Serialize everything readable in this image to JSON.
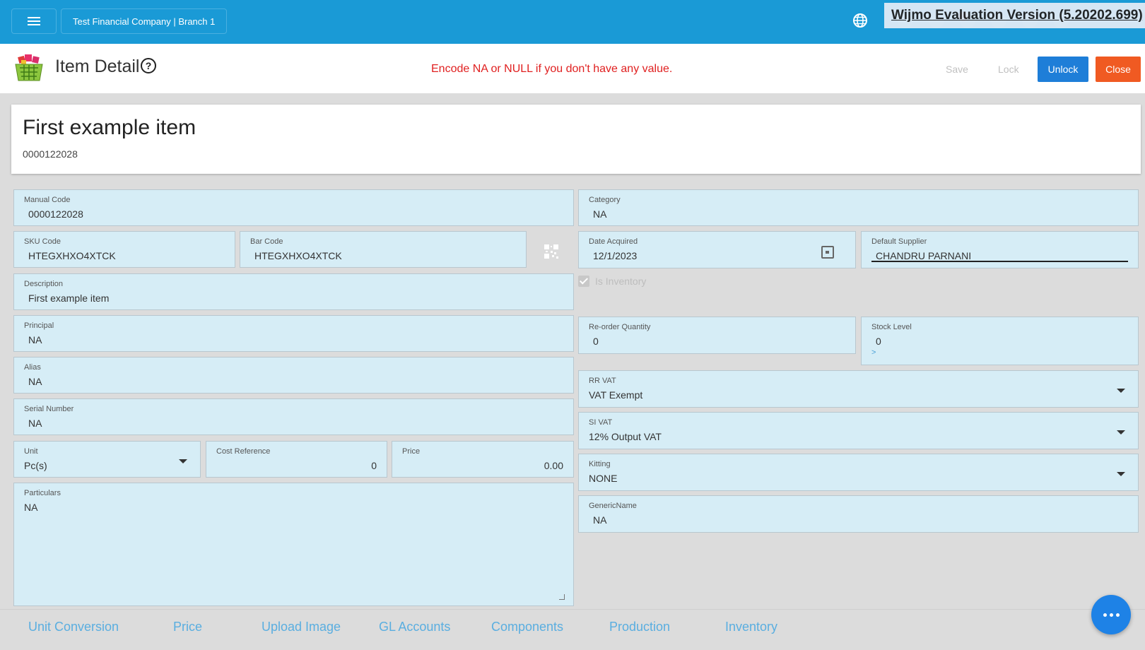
{
  "topbar": {
    "company": "Test Financial Company | Branch 1",
    "watermark": "Wijmo Evaluation Version (5.20202.699)"
  },
  "header": {
    "title": "Item Detail",
    "help_glyph": "?",
    "notice": "Encode NA or NULL if you don't have any value.",
    "buttons": {
      "save": "Save",
      "lock": "Lock",
      "unlock": "Unlock",
      "close": "Close"
    }
  },
  "card": {
    "title": "First example item",
    "code": "0000122028"
  },
  "left": {
    "manual_code": {
      "label": "Manual Code",
      "value": "0000122028"
    },
    "sku_code": {
      "label": "SKU Code",
      "value": "HTEGXHXO4XTCK"
    },
    "bar_code": {
      "label": "Bar Code",
      "value": "HTEGXHXO4XTCK"
    },
    "description": {
      "label": "Description",
      "value": "First example item"
    },
    "principal": {
      "label": "Principal",
      "value": "NA"
    },
    "alias": {
      "label": "Alias",
      "value": "NA"
    },
    "serial_number": {
      "label": "Serial Number",
      "value": "NA"
    },
    "unit": {
      "label": "Unit",
      "value": "Pc(s)"
    },
    "cost_reference": {
      "label": "Cost Reference",
      "value": "0"
    },
    "price": {
      "label": "Price",
      "value": "0.00"
    },
    "particulars": {
      "label": "Particulars",
      "value": "NA"
    }
  },
  "right": {
    "category": {
      "label": "Category",
      "value": "NA"
    },
    "date_acquired": {
      "label": "Date Acquired",
      "value": "12/1/2023"
    },
    "default_supplier": {
      "label": "Default Supplier",
      "value": "CHANDRU PARNANI"
    },
    "is_inventory": {
      "label": "Is Inventory",
      "checked": true
    },
    "reorder_quantity": {
      "label": "Re-order Quantity",
      "value": "0"
    },
    "stock_level": {
      "label": "Stock Level",
      "value": "0",
      "arrow": ">"
    },
    "rr_vat": {
      "label": "RR VAT",
      "value": "VAT Exempt"
    },
    "si_vat": {
      "label": "SI VAT",
      "value": "12% Output VAT"
    },
    "kitting": {
      "label": "Kitting",
      "value": "NONE"
    },
    "generic_name": {
      "label": "GenericName",
      "value": "NA"
    }
  },
  "tabs": [
    "Unit Conversion",
    "Price",
    "Upload Image",
    "GL Accounts",
    "Components",
    "Production",
    "Inventory"
  ],
  "colors": {
    "topbar": "#1a9ad6",
    "field": "#d6edf6",
    "unlock": "#1e7ed8",
    "close": "#f05a22",
    "notice": "#e02020",
    "tab": "#5aaee0"
  },
  "icons": {
    "menu": "hamburger-icon",
    "globe": "globe-icon",
    "basket": "basket-icon",
    "help": "help-circle-icon",
    "qr": "qr-code-icon",
    "calendar": "calendar-icon",
    "fab": "more-horizontal-icon"
  }
}
